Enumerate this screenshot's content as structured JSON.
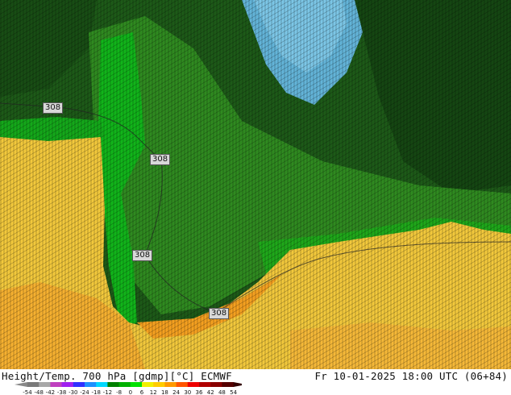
{
  "map": {
    "contour_labels": [
      "308",
      "308",
      "308",
      "308"
    ]
  },
  "footer": {
    "title": "Height/Temp. 700 hPa [gdmp][°C] ECMWF",
    "datetime": "Fr 10-01-2025 18:00 UTC (06+84)"
  },
  "legend": {
    "ticks": [
      "-54",
      "-48",
      "-42",
      "-38",
      "-30",
      "-24",
      "-18",
      "-12",
      "-8",
      "0",
      "6",
      "12",
      "18",
      "24",
      "30",
      "36",
      "42",
      "48",
      "54"
    ],
    "colors": [
      "#7a7a7a",
      "#a8a8a8",
      "#c040c0",
      "#a020f0",
      "#3030ff",
      "#1e90ff",
      "#00d8ff",
      "#008000",
      "#00b000",
      "#00e000",
      "#f0f000",
      "#ffcc00",
      "#ff9900",
      "#ff5500",
      "#ee0000",
      "#b00000",
      "#880000",
      "#550000"
    ]
  },
  "colors": {
    "dark_green": "#1d5a18",
    "mid_green": "#2f8a20",
    "bright_green": "#11b41a",
    "cold_blue": "#63b4d8",
    "yellow": "#f2c83c",
    "orange": "#f4a020"
  }
}
